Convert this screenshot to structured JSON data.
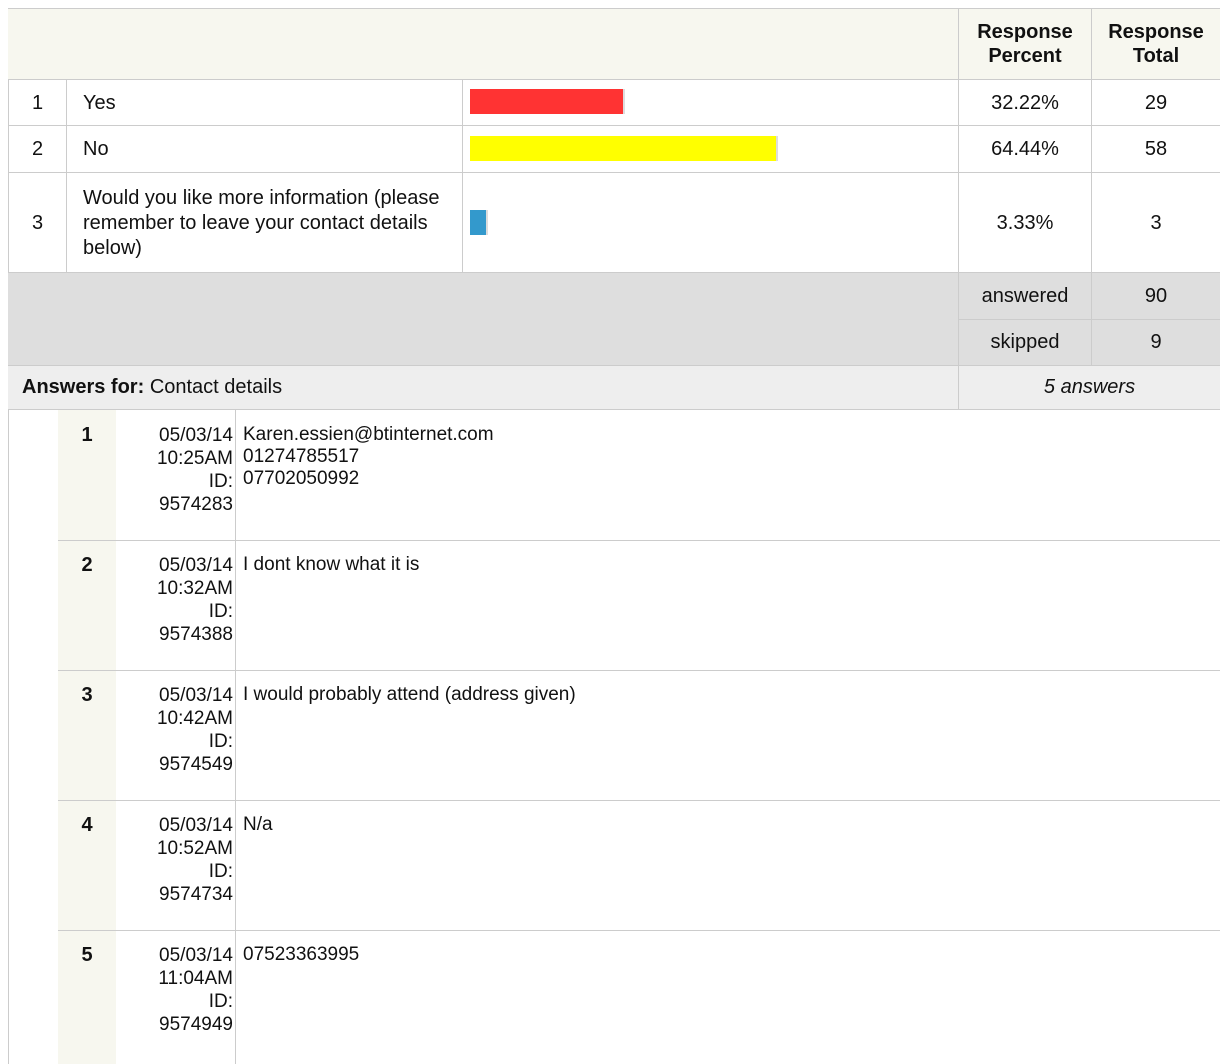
{
  "colors": {
    "bar_yes": "#ff3333",
    "bar_no": "#ffff00",
    "bar_info": "#3399cc"
  },
  "table": {
    "headers": {
      "percent": "Response\nPercent",
      "total": "Response\nTotal"
    },
    "rows": [
      {
        "num": "1",
        "label": "Yes",
        "percent": "32.22%",
        "total": "29",
        "fraction": 0.3222
      },
      {
        "num": "2",
        "label": "No",
        "percent": "64.44%",
        "total": "58",
        "fraction": 0.6444
      },
      {
        "num": "3",
        "label": "Would you like more information (please remember to leave your contact details below)",
        "percent": "3.33%",
        "total": "3",
        "fraction": 0.0333
      }
    ],
    "answered_label": "answered",
    "answered_value": "90",
    "skipped_label": "skipped",
    "skipped_value": "9"
  },
  "answers": {
    "title_bold": "Answers for:",
    "title_text": "Contact details",
    "count": "5 answers",
    "items": [
      {
        "num": "1",
        "date": "05/03/14",
        "time": "10:25AM",
        "id_label": "ID:",
        "id": "9574283",
        "text": "Karen.essien@btinternet.com\n01274785517\n07702050992"
      },
      {
        "num": "2",
        "date": "05/03/14",
        "time": "10:32AM",
        "id_label": "ID:",
        "id": "9574388",
        "text": "I dont know what it is"
      },
      {
        "num": "3",
        "date": "05/03/14",
        "time": "10:42AM",
        "id_label": "ID:",
        "id": "9574549",
        "text": "I would probably attend (address given)"
      },
      {
        "num": "4",
        "date": "05/03/14",
        "time": "10:52AM",
        "id_label": "ID:",
        "id": "9574734",
        "text": "N/a"
      },
      {
        "num": "5",
        "date": "05/03/14",
        "time": "11:04AM",
        "id_label": "ID:",
        "id": "9574949",
        "text": "07523363995"
      }
    ]
  }
}
